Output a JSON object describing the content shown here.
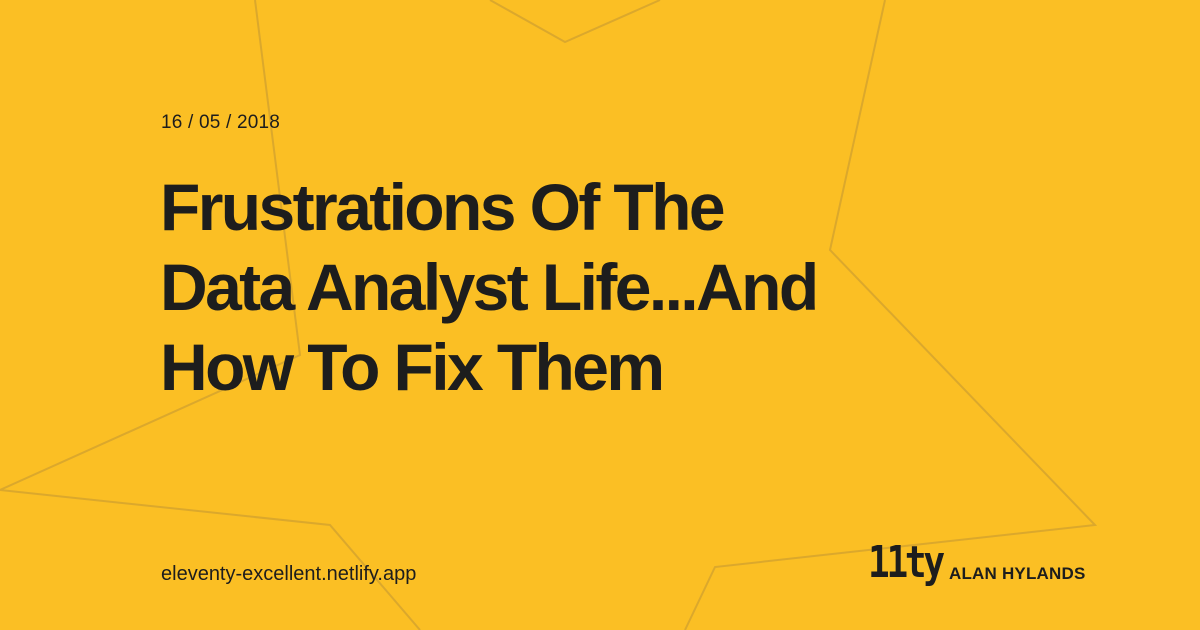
{
  "theme": {
    "background": "#fbbf24",
    "text": "#1d1d1d",
    "star_outline": "#c9a13a"
  },
  "post": {
    "date": "16 / 05 / 2018",
    "title_lines": [
      "Frustrations Of The",
      "Data Analyst Life...And",
      "How To Fix Them"
    ]
  },
  "footer": {
    "site_url": "eleventy-excellent.netlify.app",
    "logo_text": "11ty",
    "author": "ALAN HYLANDS"
  },
  "decoration": {
    "background_icon": "star-outline-icon"
  }
}
